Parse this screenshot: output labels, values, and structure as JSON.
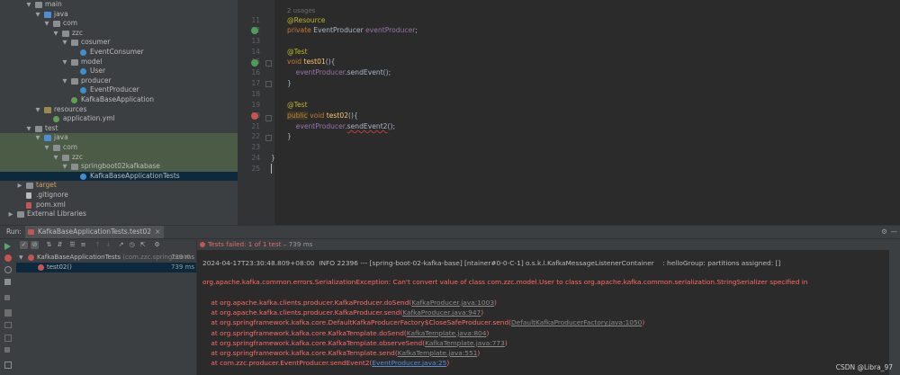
{
  "project_tree": {
    "items": [
      {
        "label": "main",
        "depth": 3,
        "icon": "folder",
        "open": true
      },
      {
        "label": "java",
        "depth": 4,
        "icon": "src",
        "open": true
      },
      {
        "label": "com",
        "depth": 5,
        "icon": "folder",
        "open": true
      },
      {
        "label": "zzc",
        "depth": 6,
        "icon": "folder",
        "open": true
      },
      {
        "label": "cosumer",
        "depth": 7,
        "icon": "folder",
        "open": true
      },
      {
        "label": "EventConsumer",
        "depth": 8,
        "icon": "class"
      },
      {
        "label": "model",
        "depth": 7,
        "icon": "folder",
        "open": true
      },
      {
        "label": "User",
        "depth": 8,
        "icon": "class"
      },
      {
        "label": "producer",
        "depth": 7,
        "icon": "folder",
        "open": true
      },
      {
        "label": "EventProducer",
        "depth": 8,
        "icon": "class"
      },
      {
        "label": "KafkaBaseApplication",
        "depth": 7,
        "icon": "spring"
      },
      {
        "label": "resources",
        "depth": 4,
        "icon": "res",
        "open": true
      },
      {
        "label": "application.yml",
        "depth": 5,
        "icon": "spring"
      },
      {
        "label": "test",
        "depth": 3,
        "icon": "folder",
        "open": true
      },
      {
        "label": "java",
        "depth": 4,
        "icon": "src",
        "open": true
      },
      {
        "label": "com",
        "depth": 5,
        "icon": "folder",
        "open": true
      },
      {
        "label": "zzc",
        "depth": 6,
        "icon": "folder",
        "open": true
      },
      {
        "label": "springboot02kafkabase",
        "depth": 7,
        "icon": "folder",
        "open": true
      },
      {
        "label": "KafkaBaseApplicationTests",
        "depth": 8,
        "icon": "class"
      },
      {
        "label": "target",
        "depth": 2,
        "icon": "folder",
        "open": false
      },
      {
        "label": ".gitignore",
        "depth": 2,
        "icon": "file"
      },
      {
        "label": "pom.xml",
        "depth": 2,
        "icon": "maven"
      },
      {
        "label": "External Libraries",
        "depth": 1,
        "icon": "lib",
        "open": false
      }
    ]
  },
  "editor": {
    "usages_hint": "2 usages",
    "lines": [
      {
        "num": "11"
      },
      {
        "num": "12"
      },
      {
        "num": "13"
      },
      {
        "num": "14"
      },
      {
        "num": "15"
      },
      {
        "num": "16"
      },
      {
        "num": "17"
      },
      {
        "num": "18"
      },
      {
        "num": "19"
      },
      {
        "num": "20"
      },
      {
        "num": "21"
      },
      {
        "num": "22"
      },
      {
        "num": "23"
      },
      {
        "num": "24"
      },
      {
        "num": "25"
      }
    ],
    "code": {
      "resource": "@Resource",
      "private_kw": "private",
      "producer_type": "EventProducer",
      "producer_field": "eventProducer",
      "semi": ";",
      "test_ann1": "@Test",
      "void_kw1": "void",
      "test01": "test01",
      "paren_open1": "(){",
      "call1_obj": "eventProducer",
      "call1_rest": ".sendEvent();",
      "close1": "}",
      "test_ann2": "@Test",
      "public_kw": "public",
      "void_kw2": "void",
      "test02": "test02",
      "paren_open2": "(){",
      "call2_obj": "eventProducer",
      "call2_dot": ".",
      "call2_method": "sendEvent2",
      "call2_end": "();",
      "close2": "}",
      "class_close": "}"
    }
  },
  "run_panel": {
    "run_label": "Run:",
    "tab_label": "KafkaBaseApplicationTests.test02",
    "tab_close": "×",
    "gear": "⚙",
    "minimize": "—",
    "test_tree": {
      "root_label": "KafkaBaseApplicationTests",
      "root_pkg": "(com.zzc.springboot0",
      "root_time": "739 ms",
      "child_label": "test02()",
      "child_time": "739 ms"
    },
    "status": {
      "text": "Tests failed: 1 of 1 test",
      "time": " – 739 ms"
    },
    "console": {
      "line_top": "2024-04-17T23:30:48.809+08:00  INFO 22396 --- [spring-boot-02-kafka-base] [ntainer#0-0-C-1] o.s.k.l.KafkaMessageListenerContainer    : helloGroup: partitions assigned: []",
      "exception": "org.apache.kafka.common.errors.SerializationException: Can't convert value of class com.zzc.model.User to class org.apache.kafka.common.serialization.StringSerializer specified in",
      "stack": [
        {
          "prefix": "    at org.apache.kafka.clients.producer.KafkaProducer.doSend(",
          "link": "KafkaProducer.java:1003",
          "suffix": ")"
        },
        {
          "prefix": "    at org.apache.kafka.clients.producer.KafkaProducer.send(",
          "link": "KafkaProducer.java:947",
          "suffix": ")"
        },
        {
          "prefix": "    at org.springframework.kafka.core.DefaultKafkaProducerFactory$CloseSafeProducer.send(",
          "link": "DefaultKafkaProducerFactory.java:1050",
          "suffix": ")"
        },
        {
          "prefix": "    at org.springframework.kafka.core.KafkaTemplate.doSend(",
          "link": "KafkaTemplate.java:804",
          "suffix": ")"
        },
        {
          "prefix": "    at org.springframework.kafka.core.KafkaTemplate.observeSend(",
          "link": "KafkaTemplate.java:773",
          "suffix": ")"
        },
        {
          "prefix": "    at org.springframework.kafka.core.KafkaTemplate.send(",
          "link": "KafkaTemplate.java:551",
          "suffix": ")"
        },
        {
          "prefix": "    at com.zzc.producer.EventProducer.sendEvent2(",
          "link": "EventProducer.java:25",
          "suffix": ")"
        }
      ]
    }
  },
  "watermark": "CSDN @Libra_97",
  "colors": {
    "editor_bg": "#2b2b2b",
    "panel_bg": "#3c3f41",
    "error_red": "#ff6b68",
    "keyword": "#cc7832",
    "annotation": "#bbb529",
    "method": "#ffc66d",
    "field": "#9876aa",
    "link_blue": "#5a8dd6"
  }
}
